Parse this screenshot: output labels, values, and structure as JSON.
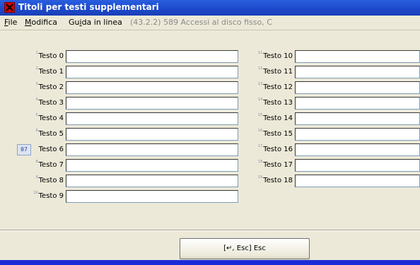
{
  "window": {
    "title": "Titoli per testi supplementari"
  },
  "menu": {
    "file": "File",
    "modifica": "Modifica",
    "guida": "Guida in linea",
    "info": "(43.2.2) 589 Accessi al disco fisso, C"
  },
  "left_fields": [
    {
      "num": "1",
      "label": "Testo 0",
      "value": ""
    },
    {
      "num": "2",
      "label": "Testo 1",
      "value": ""
    },
    {
      "num": "3",
      "label": "Testo 2",
      "value": ""
    },
    {
      "num": "4",
      "label": "Testo 3",
      "value": ""
    },
    {
      "num": "5",
      "label": "Testo 4",
      "value": ""
    },
    {
      "num": "6",
      "label": "Testo 5",
      "value": ""
    },
    {
      "num": "07",
      "label": "Testo 6",
      "value": "",
      "badge": true
    },
    {
      "num": "8",
      "label": "Testo 7",
      "value": ""
    },
    {
      "num": "9",
      "label": "Testo 8",
      "value": ""
    },
    {
      "num": "10",
      "label": "Testo 9",
      "value": ""
    }
  ],
  "right_fields": [
    {
      "num": "11",
      "label": "Testo 10",
      "value": ""
    },
    {
      "num": "12",
      "label": "Testo 11",
      "value": ""
    },
    {
      "num": "13",
      "label": "Testo 12",
      "value": ""
    },
    {
      "num": "14",
      "label": "Testo 13",
      "value": ""
    },
    {
      "num": "15",
      "label": "Testo 14",
      "value": ""
    },
    {
      "num": "16",
      "label": "Testo 15",
      "value": ""
    },
    {
      "num": "17",
      "label": "Testo 16",
      "value": ""
    },
    {
      "num": "18",
      "label": "Testo 17",
      "value": ""
    },
    {
      "num": "19",
      "label": "Testo 18",
      "value": ""
    }
  ],
  "footer": {
    "button_label": "[↵, Esc] Esc"
  },
  "colors": {
    "titlebar": "#1c48c8",
    "background": "#ece9d8",
    "desktop": "#1b2bd6",
    "close_icon": "#d40000"
  }
}
